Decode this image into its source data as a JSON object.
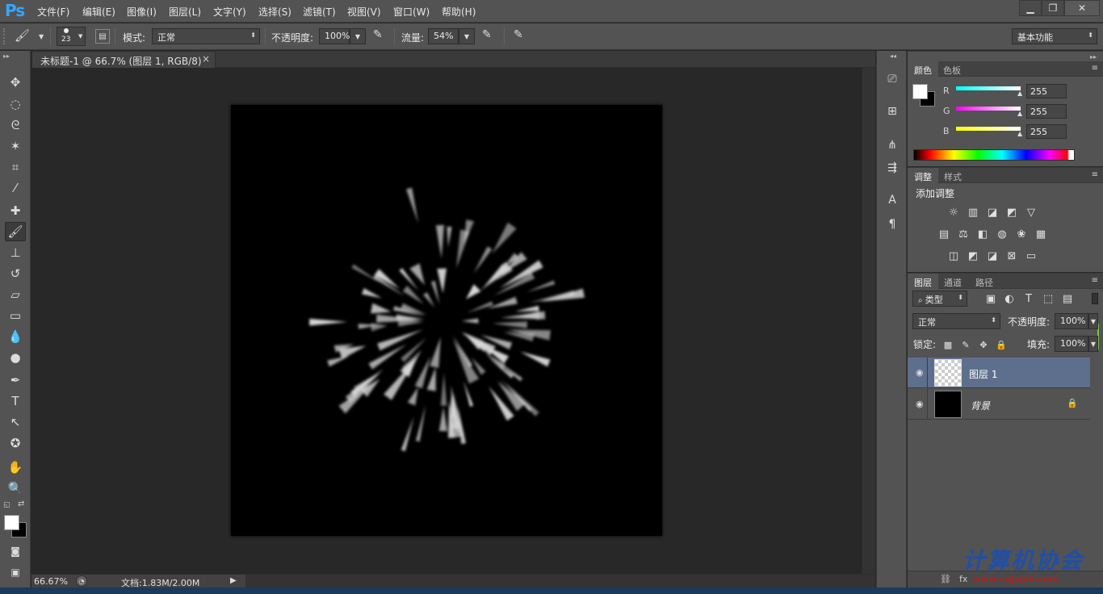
{
  "app": {
    "logo": "Ps"
  },
  "menu": [
    "文件(F)",
    "编辑(E)",
    "图像(I)",
    "图层(L)",
    "文字(Y)",
    "选择(S)",
    "滤镜(T)",
    "视图(V)",
    "窗口(W)",
    "帮助(H)"
  ],
  "window_controls": {
    "minimize": "▁",
    "restore": "❐",
    "close": "✕"
  },
  "options": {
    "brush_size": "23",
    "mode_label": "模式:",
    "mode_value": "正常",
    "opacity_label": "不透明度:",
    "opacity_value": "100%",
    "flow_label": "流量:",
    "flow_value": "54%",
    "workspace": "基本功能"
  },
  "document": {
    "tab_title": "未标题-1 @ 66.7% (图层 1, RGB/8) *",
    "tab_close": "×",
    "zoom": "66.67%",
    "doc_info": "文档:1.83M/2.00M",
    "canvas_background": "#000000"
  },
  "color_panel": {
    "tabs": [
      "颜色",
      "色板"
    ],
    "channels": [
      {
        "label": "R",
        "value": "255",
        "gradient_start": "#00ffff",
        "gradient_end": "#ffffff"
      },
      {
        "label": "G",
        "value": "255",
        "gradient_start": "#ff00ff",
        "gradient_end": "#ffffff"
      },
      {
        "label": "B",
        "value": "255",
        "gradient_start": "#ffff00",
        "gradient_end": "#ffffff"
      }
    ],
    "foreground": "#ffffff",
    "background": "#000000"
  },
  "adjust_panel": {
    "tabs": [
      "调整",
      "样式"
    ],
    "title": "添加调整"
  },
  "layers_panel": {
    "tabs": [
      "图层",
      "通道",
      "路径"
    ],
    "filter_label": "类型",
    "blend_mode": "正常",
    "opacity_label": "不透明度:",
    "opacity_value": "100%",
    "lock_label": "锁定:",
    "fill_label": "填充:",
    "fill_value": "100%",
    "layers": [
      {
        "name": "图层 1",
        "selected": true,
        "thumb": "transparent"
      },
      {
        "name": "背景",
        "selected": false,
        "thumb": "black",
        "locked": true
      }
    ]
  },
  "watermark": {
    "text": "计算机协会",
    "url_fragment": "www.cqjsjxh.com"
  }
}
